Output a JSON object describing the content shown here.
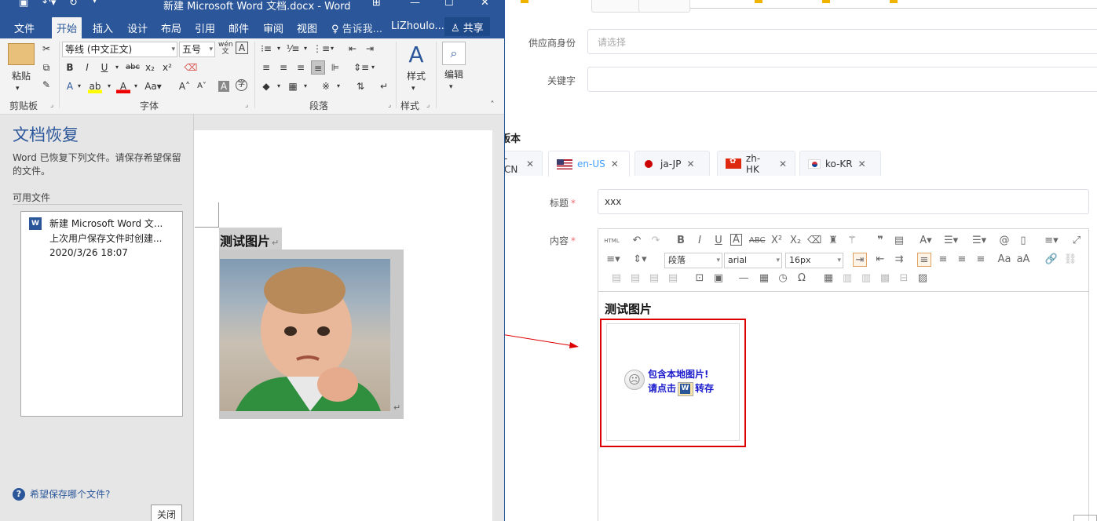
{
  "word": {
    "title": "新建 Microsoft Word 文档.docx - Word",
    "menu_tabs": [
      "文件",
      "开始",
      "插入",
      "设计",
      "布局",
      "引用",
      "邮件",
      "审阅",
      "视图"
    ],
    "active_tab": "开始",
    "tell_me": "告诉我...",
    "user": "LiZhoulo...",
    "share": "共享",
    "ribbon": {
      "paste_label": "粘贴",
      "clipboard_label": "剪贴板",
      "font_name": "等线 (中文正文)",
      "font_size": "五号",
      "font_group_label": "字体",
      "paragraph_group_label": "段落",
      "styles_label": "样式",
      "styles_group_label": "样式",
      "edit_label": "编辑"
    },
    "recovery": {
      "title": "文档恢复",
      "description": "Word 已恢复下列文件。请保存希望保留的文件。",
      "available_label": "可用文件",
      "file_name": "新建 Microsoft Word 文...",
      "file_sub": "上次用户保存文件时创建...",
      "file_date": "2020/3/26 18:07",
      "help_link": "希望保存哪个文件?",
      "close_button": "关闭"
    },
    "document": {
      "heading": "测试图片",
      "para_mark": "↵"
    }
  },
  "web": {
    "supplier_label": "供应商身份",
    "supplier_placeholder": "请选择",
    "keyword_label": "关键字",
    "keyword_value": "",
    "section_title": "版本",
    "tabs": [
      {
        "label": "-CN",
        "flag": "none"
      },
      {
        "label": "en-US",
        "flag": "us"
      },
      {
        "label": "ja-JP",
        "flag": "jp"
      },
      {
        "label": "zh-HK",
        "flag": "hk"
      },
      {
        "label": "ko-KR",
        "flag": "kr"
      }
    ],
    "active_tab": "en-US",
    "title_label": "标题",
    "title_value": "xxx",
    "content_label": "内容",
    "required_mark": "*",
    "editor": {
      "html_button": "HTML",
      "paragraph_select": "段落",
      "font_select": "arial",
      "size_select": "16px",
      "content_heading": "测试图片",
      "placeholder_line1": "包含本地图片!",
      "placeholder_line2_a": "请点击",
      "placeholder_line2_b": "转存"
    }
  },
  "colors": {
    "word_blue": "#2b579a",
    "annotation_red": "#dd0000",
    "active_tab_blue": "#409eff"
  }
}
